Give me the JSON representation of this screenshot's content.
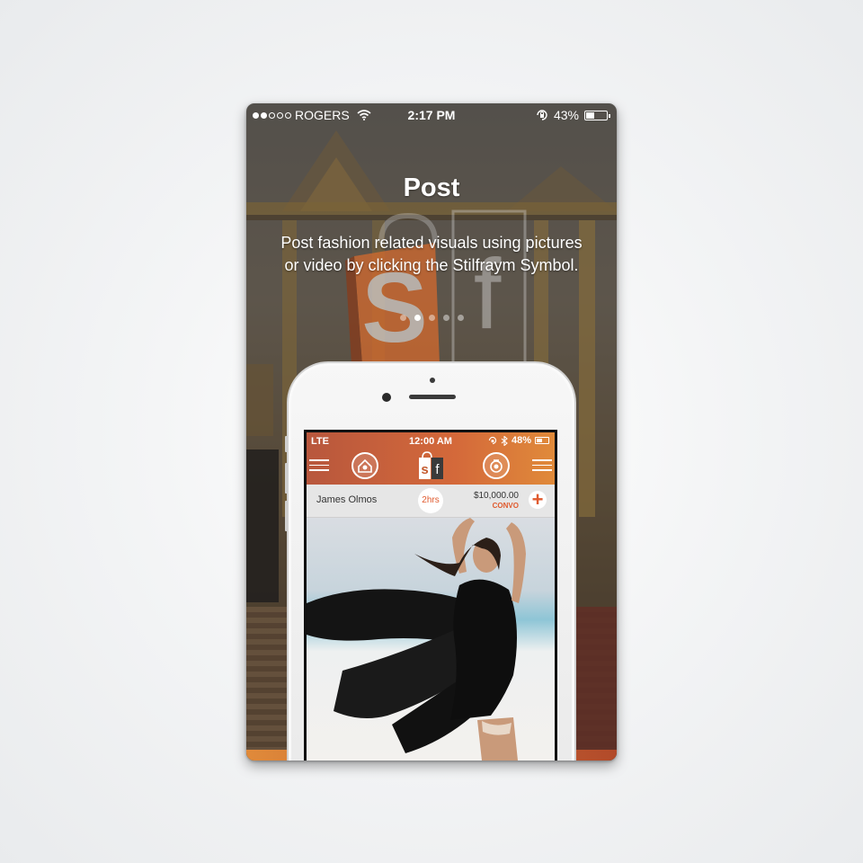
{
  "status_bar": {
    "carrier": "ROGERS",
    "time": "2:17 PM",
    "battery_percent": "43%",
    "battery_level": 0.43,
    "signal_bars_filled": 2,
    "signal_bars_total": 5
  },
  "onboarding": {
    "title": "Post",
    "description_line1": "Post fashion related visuals using pictures",
    "description_line2": "or video by clicking the Stilfraym Symbol.",
    "pager_count": 5,
    "pager_active_index": 1
  },
  "background_logo": {
    "letter_s": "S",
    "letter_f": "f"
  },
  "app_preview": {
    "status": {
      "network": "LTE",
      "time": "12:00 AM",
      "battery_percent": "48%",
      "battery_level": 0.48
    },
    "logo": {
      "s": "s",
      "f": "f"
    },
    "post_row": {
      "user_name": "James Olmos",
      "time_ago": "2hrs",
      "price": "$10,000.00",
      "convo_label": "CONVO",
      "add_symbol": "+"
    }
  },
  "colors": {
    "accent_orange": "#e05a2e",
    "header_gradient_start": "#b8573d",
    "header_gradient_end": "#e08a3a"
  },
  "icons": [
    "wifi-icon",
    "orientation-lock-icon",
    "battery-icon",
    "bluetooth-icon",
    "hamburger-menu-icon",
    "home-icon",
    "camera-icon",
    "plus-icon"
  ]
}
